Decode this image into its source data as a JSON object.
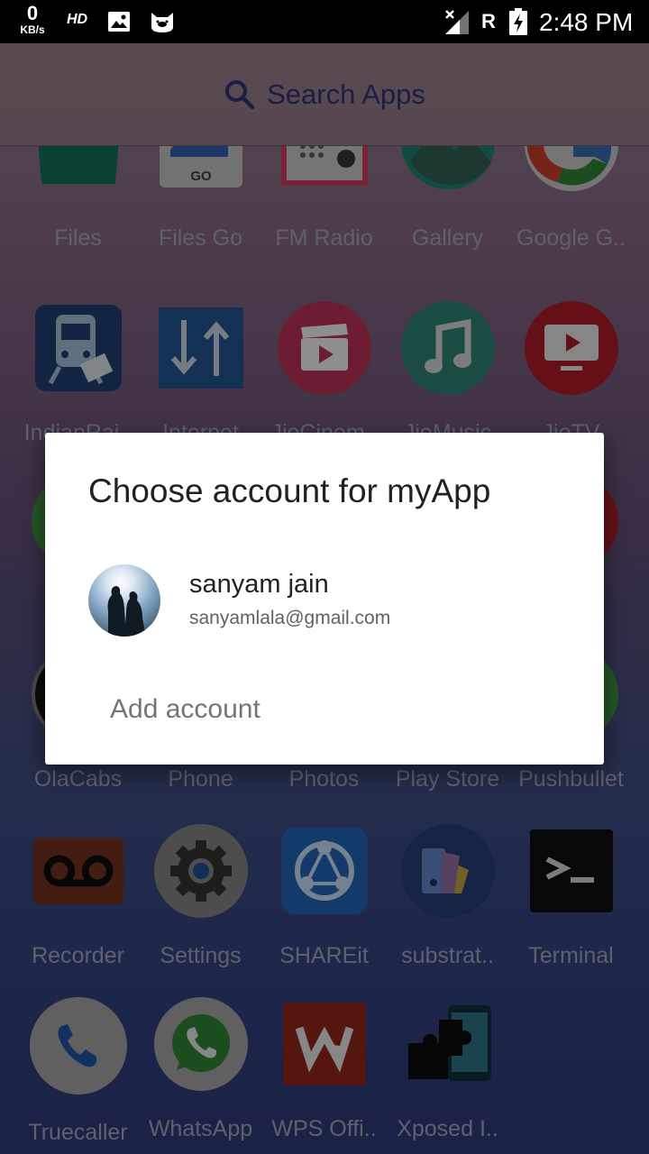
{
  "status_bar": {
    "net_speed": "0",
    "net_unit": "KB/s",
    "hd": "HD",
    "roaming": "R",
    "time": "2:48 PM"
  },
  "search": {
    "placeholder": "Search Apps"
  },
  "apps": [
    {
      "label": "Files",
      "icon": "folder-icon"
    },
    {
      "label": "Files Go",
      "icon": "files-go-icon"
    },
    {
      "label": "FM Radio",
      "icon": "radio-icon"
    },
    {
      "label": "Gallery",
      "icon": "gallery-icon"
    },
    {
      "label": "Google G..",
      "icon": "google-icon"
    },
    {
      "label": "IndianRai..",
      "icon": "train-icon"
    },
    {
      "label": "Internet",
      "icon": "internet-icon"
    },
    {
      "label": "JioCinem..",
      "icon": "clapper-icon"
    },
    {
      "label": "JioMusic",
      "icon": "music-icon"
    },
    {
      "label": "JioTV",
      "icon": "tv-icon"
    },
    {
      "label": "OlaCabs",
      "icon": "ola-icon"
    },
    {
      "label": "Phone",
      "icon": "phone-icon"
    },
    {
      "label": "Photos",
      "icon": "photos-icon"
    },
    {
      "label": "Play Store",
      "icon": "play-store-icon"
    },
    {
      "label": "Pushbullet",
      "icon": "pushbullet-icon"
    },
    {
      "label": "Recorder",
      "icon": "voicemail-icon"
    },
    {
      "label": "Settings",
      "icon": "gear-icon"
    },
    {
      "label": "SHAREit",
      "icon": "shareit-icon"
    },
    {
      "label": "substrat..",
      "icon": "substratum-icon"
    },
    {
      "label": "Terminal",
      "icon": "terminal-icon"
    },
    {
      "label": "Truecaller",
      "icon": "truecaller-icon"
    },
    {
      "label": "WhatsApp",
      "icon": "whatsapp-icon"
    },
    {
      "label": "WPS Offi..",
      "icon": "wps-icon"
    },
    {
      "label": "Xposed I..",
      "icon": "puzzle-icon"
    }
  ],
  "dialog": {
    "title": "Choose account for myApp",
    "account": {
      "name": "sanyam jain",
      "email": "sanyamlala@gmail.com"
    },
    "add_account": "Add account"
  }
}
